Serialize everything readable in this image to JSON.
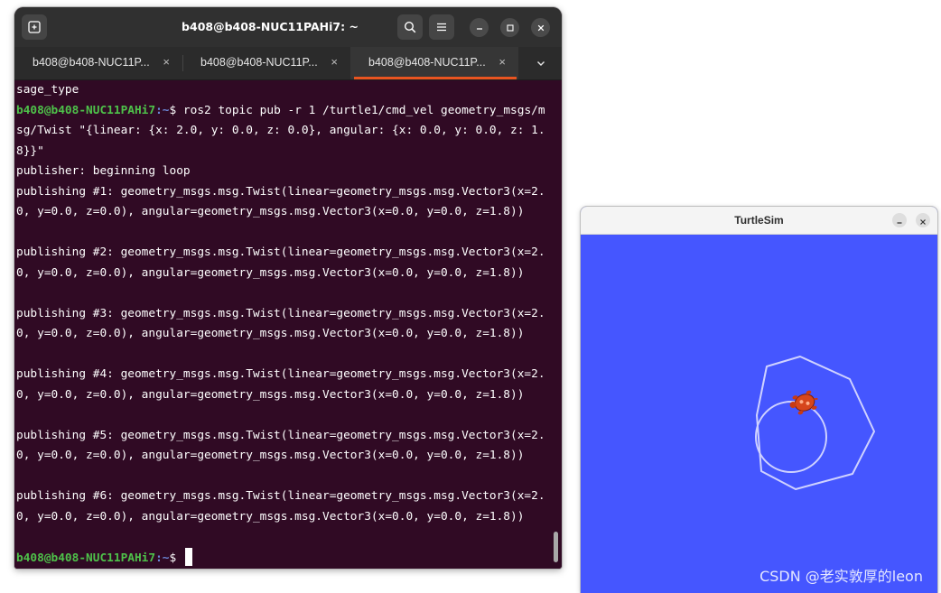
{
  "terminal": {
    "title": "b408@b408-NUC11PAHi7: ~",
    "tabs": [
      {
        "label": "b408@b408-NUC11P...",
        "close": "×"
      },
      {
        "label": "b408@b408-NUC11P...",
        "close": "×"
      },
      {
        "label": "b408@b408-NUC11P...",
        "close": "×"
      }
    ],
    "active_tab": 2,
    "accent_color": "#e95420",
    "background_color": "#300a24",
    "lines": [
      {
        "text": "sage_type"
      },
      {
        "user": "b408@b408-NUC11PAHi7",
        "path": ":~",
        "text": "$ ros2 topic pub -r 1 /turtle1/cmd_vel geometry_msgs/m"
      },
      {
        "text": "sg/Twist \"{linear: {x: 2.0, y: 0.0, z: 0.0}, angular: {x: 0.0, y: 0.0, z: 1."
      },
      {
        "text": "8}}\""
      },
      {
        "text": "publisher: beginning loop"
      },
      {
        "text": "publishing #1: geometry_msgs.msg.Twist(linear=geometry_msgs.msg.Vector3(x=2."
      },
      {
        "text": "0, y=0.0, z=0.0), angular=geometry_msgs.msg.Vector3(x=0.0, y=0.0, z=1.8))"
      },
      {
        "text": ""
      },
      {
        "text": "publishing #2: geometry_msgs.msg.Twist(linear=geometry_msgs.msg.Vector3(x=2."
      },
      {
        "text": "0, y=0.0, z=0.0), angular=geometry_msgs.msg.Vector3(x=0.0, y=0.0, z=1.8))"
      },
      {
        "text": ""
      },
      {
        "text": "publishing #3: geometry_msgs.msg.Twist(linear=geometry_msgs.msg.Vector3(x=2."
      },
      {
        "text": "0, y=0.0, z=0.0), angular=geometry_msgs.msg.Vector3(x=0.0, y=0.0, z=1.8))"
      },
      {
        "text": ""
      },
      {
        "text": "publishing #4: geometry_msgs.msg.Twist(linear=geometry_msgs.msg.Vector3(x=2."
      },
      {
        "text": "0, y=0.0, z=0.0), angular=geometry_msgs.msg.Vector3(x=0.0, y=0.0, z=1.8))"
      },
      {
        "text": ""
      },
      {
        "text": "publishing #5: geometry_msgs.msg.Twist(linear=geometry_msgs.msg.Vector3(x=2."
      },
      {
        "text": "0, y=0.0, z=0.0), angular=geometry_msgs.msg.Vector3(x=0.0, y=0.0, z=1.8))"
      },
      {
        "text": ""
      },
      {
        "text": "publishing #6: geometry_msgs.msg.Twist(linear=geometry_msgs.msg.Vector3(x=2."
      },
      {
        "text": "0, y=0.0, z=0.0), angular=geometry_msgs.msg.Vector3(x=0.0, y=0.0, z=1.8))"
      },
      {
        "text": ""
      },
      {
        "user": "b408@b408-NUC11PAHi7",
        "path": ":~",
        "text": "$ ",
        "cursor": true
      }
    ],
    "icons": {
      "new_tab": "new-tab-icon",
      "search": "search-icon",
      "menu": "hamburger-menu-icon",
      "minimize": "minimize-icon",
      "maximize": "maximize-icon",
      "close": "close-icon",
      "tabs_dropdown": "chevron-down-icon"
    }
  },
  "turtlesim": {
    "title": "TurtleSim",
    "background_color": "#4556ff",
    "trail_color": "#c8ccff",
    "icons": {
      "minimize": "minimize-icon",
      "close": "close-icon",
      "turtle": "turtle-icon"
    }
  },
  "watermark": "CSDN @老实敦厚的leon"
}
